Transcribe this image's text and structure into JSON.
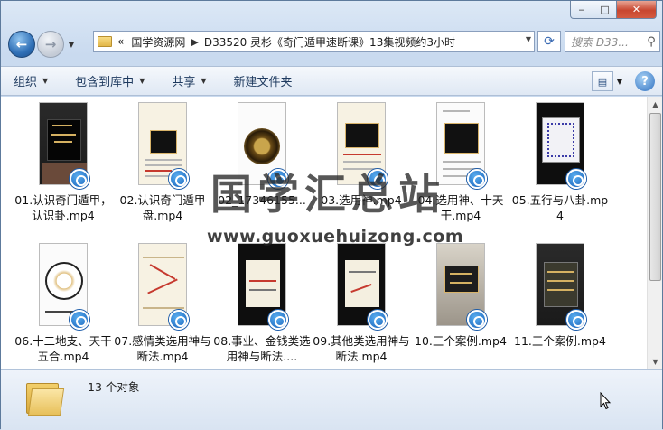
{
  "window": {
    "caption": {
      "minimize": "‒",
      "maximize": "□",
      "close": "✕"
    }
  },
  "navbar": {
    "back_icon": "←",
    "forward_icon": "→",
    "breadcrumb_prefix": "«",
    "breadcrumb": [
      "国学资源网",
      "D33520 灵杉《奇门遁甲速断课》13集视频约3小时"
    ],
    "search_placeholder": "搜索 D33..."
  },
  "toolbar": {
    "items": [
      "组织",
      "包含到库中",
      "共享",
      "新建文件夹"
    ],
    "help": "?"
  },
  "files": [
    {
      "label": "01.认识奇门遁甲，认识卦.mp4",
      "thumb": "phone"
    },
    {
      "label": "02.认识奇门遁甲盘.mp4",
      "thumb": "paper"
    },
    {
      "label": "02_17346155...",
      "thumb": "coin"
    },
    {
      "label": "03.选用神.mp4",
      "thumb": "paper2"
    },
    {
      "label": "04.选用神、十天干.mp4",
      "thumb": "white"
    },
    {
      "label": "05.五行与八卦.mp4",
      "thumb": "dark"
    },
    {
      "label": "06.十二地支、天干五合.mp4",
      "thumb": "bagua"
    },
    {
      "label": "07.感情类选用神与断法.mp4",
      "thumb": "sketch"
    },
    {
      "label": "08.事业、金钱类选用神与断法....",
      "thumb": "dark2"
    },
    {
      "label": "09.其他类选用神与断法.mp4",
      "thumb": "dark3"
    },
    {
      "label": "10.三个案例.mp4",
      "thumb": "case"
    },
    {
      "label": "11.三个案例.mp4",
      "thumb": "phone2"
    }
  ],
  "watermark": {
    "title": "国学汇总站",
    "url": "www.guoxuehuizong.com"
  },
  "status": {
    "count_text": "13 个对象"
  },
  "colors": {
    "accent": "#1760b8",
    "close": "#c8462f"
  }
}
